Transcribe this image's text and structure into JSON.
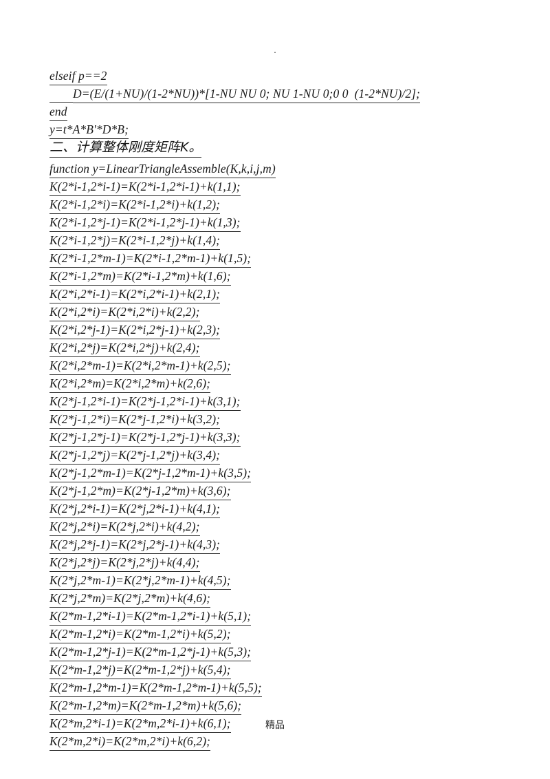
{
  "page": {
    "top_mark": ".",
    "footer": "精品"
  },
  "code": {
    "lines": [
      {
        "text": "elseif p==2",
        "style": "plain"
      },
      {
        "text": "D=(E/(1+NU)/(1-2*NU))*[1-NU NU 0; NU 1-NU 0;0 0  (1-2*NU)/2];",
        "style": "indent"
      },
      {
        "text": "end",
        "style": "plain"
      },
      {
        "text": "y=t*A*B'*D*B;",
        "style": "plain"
      },
      {
        "text": "二、计算整体刚度矩阵K。",
        "style": "heading"
      },
      {
        "text": "function y=LinearTriangleAssemble(K,k,i,j,m)",
        "style": "gap-before"
      },
      {
        "text": "K(2*i-1,2*i-1)=K(2*i-1,2*i-1)+k(1,1);",
        "style": "plain"
      },
      {
        "text": "K(2*i-1,2*i)=K(2*i-1,2*i)+k(1,2);",
        "style": "plain"
      },
      {
        "text": "K(2*i-1,2*j-1)=K(2*i-1,2*j-1)+k(1,3);",
        "style": "plain"
      },
      {
        "text": "K(2*i-1,2*j)=K(2*i-1,2*j)+k(1,4);",
        "style": "plain"
      },
      {
        "text": "K(2*i-1,2*m-1)=K(2*i-1,2*m-1)+k(1,5);",
        "style": "plain"
      },
      {
        "text": "K(2*i-1,2*m)=K(2*i-1,2*m)+k(1,6);",
        "style": "plain"
      },
      {
        "text": "K(2*i,2*i-1)=K(2*i,2*i-1)+k(2,1);",
        "style": "plain"
      },
      {
        "text": "K(2*i,2*i)=K(2*i,2*i)+k(2,2);",
        "style": "plain"
      },
      {
        "text": "K(2*i,2*j-1)=K(2*i,2*j-1)+k(2,3);",
        "style": "plain"
      },
      {
        "text": "K(2*i,2*j)=K(2*i,2*j)+k(2,4);",
        "style": "plain"
      },
      {
        "text": "K(2*i,2*m-1)=K(2*i,2*m-1)+k(2,5);",
        "style": "plain"
      },
      {
        "text": "K(2*i,2*m)=K(2*i,2*m)+k(2,6);",
        "style": "plain"
      },
      {
        "text": "K(2*j-1,2*i-1)=K(2*j-1,2*i-1)+k(3,1);",
        "style": "plain"
      },
      {
        "text": "K(2*j-1,2*i)=K(2*j-1,2*i)+k(3,2);",
        "style": "plain"
      },
      {
        "text": "K(2*j-1,2*j-1)=K(2*j-1,2*j-1)+k(3,3);",
        "style": "plain"
      },
      {
        "text": "K(2*j-1,2*j)=K(2*j-1,2*j)+k(3,4);",
        "style": "plain"
      },
      {
        "text": "K(2*j-1,2*m-1)=K(2*j-1,2*m-1)+k(3,5);",
        "style": "plain"
      },
      {
        "text": "K(2*j-1,2*m)=K(2*j-1,2*m)+k(3,6);",
        "style": "plain"
      },
      {
        "text": "K(2*j,2*i-1)=K(2*j,2*i-1)+k(4,1);",
        "style": "plain"
      },
      {
        "text": "K(2*j,2*i)=K(2*j,2*i)+k(4,2);",
        "style": "plain"
      },
      {
        "text": "K(2*j,2*j-1)=K(2*j,2*j-1)+k(4,3);",
        "style": "plain"
      },
      {
        "text": "K(2*j,2*j)=K(2*j,2*j)+k(4,4);",
        "style": "plain"
      },
      {
        "text": "K(2*j,2*m-1)=K(2*j,2*m-1)+k(4,5);",
        "style": "plain"
      },
      {
        "text": "K(2*j,2*m)=K(2*j,2*m)+k(4,6);",
        "style": "plain"
      },
      {
        "text": "K(2*m-1,2*i-1)=K(2*m-1,2*i-1)+k(5,1);",
        "style": "plain"
      },
      {
        "text": "K(2*m-1,2*i)=K(2*m-1,2*i)+k(5,2);",
        "style": "plain"
      },
      {
        "text": "K(2*m-1,2*j-1)=K(2*m-1,2*j-1)+k(5,3);",
        "style": "plain"
      },
      {
        "text": "K(2*m-1,2*j)=K(2*m-1,2*j)+k(5,4);",
        "style": "plain"
      },
      {
        "text": "K(2*m-1,2*m-1)=K(2*m-1,2*m-1)+k(5,5);",
        "style": "plain"
      },
      {
        "text": "K(2*m-1,2*m)=K(2*m-1,2*m)+k(5,6);",
        "style": "plain"
      },
      {
        "text": "K(2*m,2*i-1)=K(2*m,2*i-1)+k(6,1);",
        "style": "plain"
      },
      {
        "text": "K(2*m,2*i)=K(2*m,2*i)+k(6,2);",
        "style": "plain"
      }
    ]
  }
}
